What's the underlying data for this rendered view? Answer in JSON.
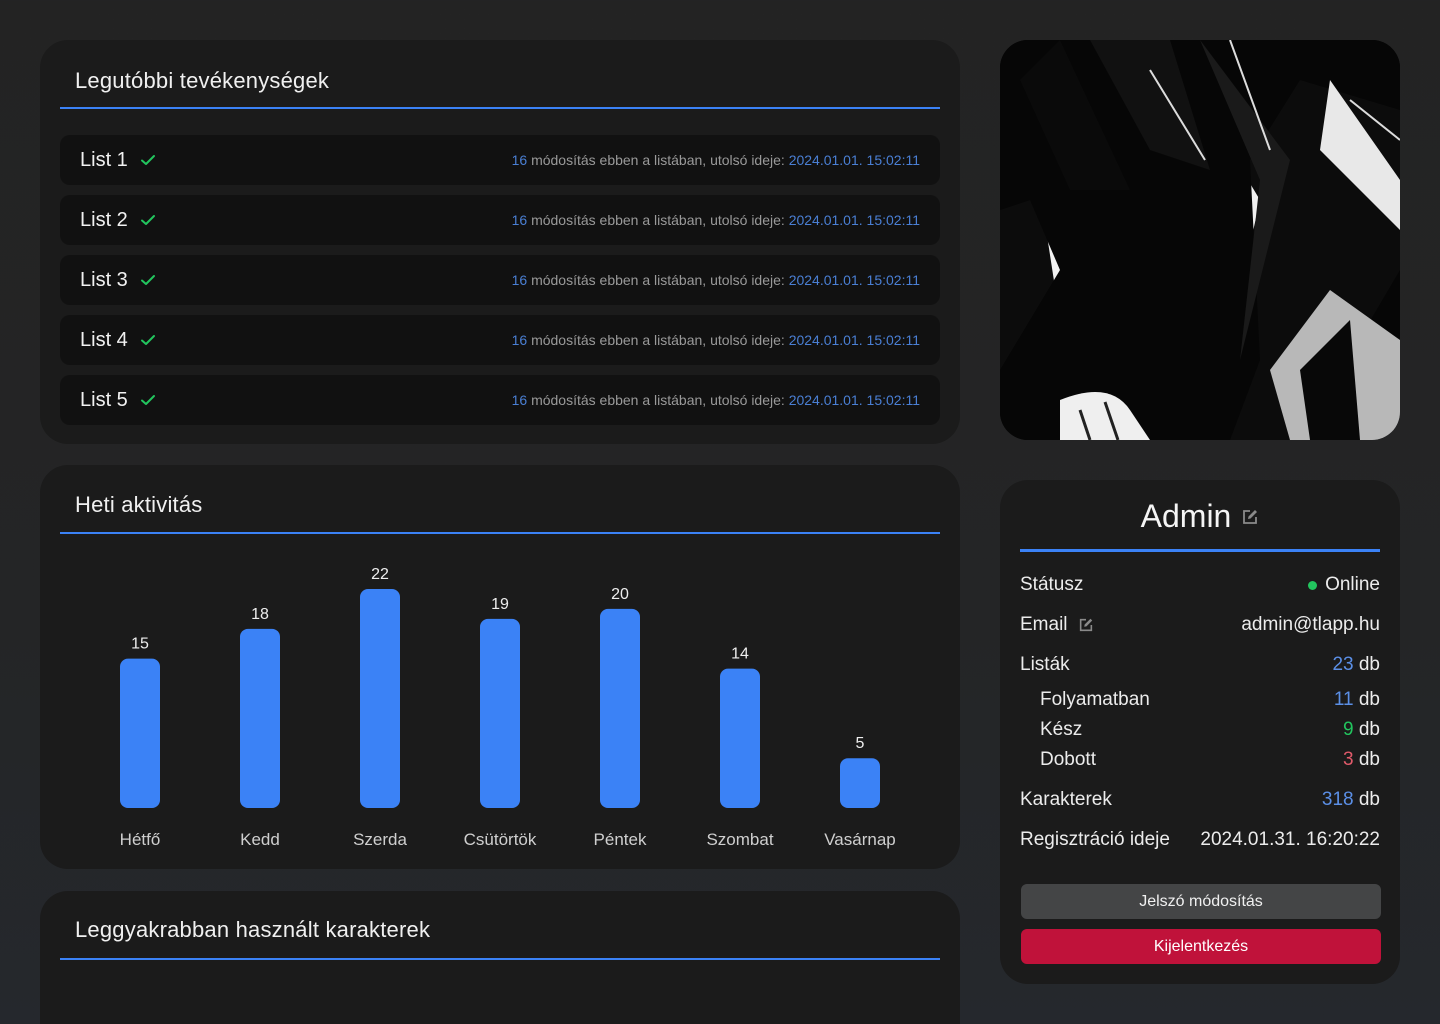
{
  "recent": {
    "title": "Legutóbbi tevékenységek",
    "items": [
      {
        "name": "List 1",
        "count": "16",
        "text": "módosítás ebben a listában, utolsó ideje:",
        "time": "2024.01.01. 15:02:11"
      },
      {
        "name": "List 2",
        "count": "16",
        "text": "módosítás ebben a listában, utolsó ideje:",
        "time": "2024.01.01. 15:02:11"
      },
      {
        "name": "List 3",
        "count": "16",
        "text": "módosítás ebben a listában, utolsó ideje:",
        "time": "2024.01.01. 15:02:11"
      },
      {
        "name": "List 4",
        "count": "16",
        "text": "módosítás ebben a listában, utolsó ideje:",
        "time": "2024.01.01. 15:02:11"
      },
      {
        "name": "List 5",
        "count": "16",
        "text": "módosítás ebben a listában, utolsó ideje:",
        "time": "2024.01.01. 15:02:11"
      }
    ]
  },
  "weekly": {
    "title": "Heti aktivitás"
  },
  "chart_data": {
    "type": "bar",
    "categories": [
      "Hétfő",
      "Kedd",
      "Szerda",
      "Csütörtök",
      "Péntek",
      "Szombat",
      "Vasárnap"
    ],
    "values": [
      15,
      18,
      22,
      19,
      20,
      14,
      5
    ],
    "title": "Heti aktivitás",
    "xlabel": "",
    "ylabel": "",
    "ylim": [
      0,
      22
    ],
    "grid": false,
    "bar_color": "#3b82f6"
  },
  "chars": {
    "title": "Leggyakrabban használt karakterek"
  },
  "avatar": {
    "icon": "avatar-image"
  },
  "profile": {
    "name": "Admin",
    "status_label": "Státusz",
    "status_value": "Online",
    "email_label": "Email",
    "email_value": "admin@tlapp.hu",
    "lists_label": "Listák",
    "lists_value": "23",
    "in_progress_label": "Folyamatban",
    "in_progress_value": "11",
    "done_label": "Kész",
    "done_value": "9",
    "dropped_label": "Dobott",
    "dropped_value": "3",
    "chars_label": "Karakterek",
    "chars_value": "318",
    "reg_label": "Regisztráció ideje",
    "reg_value": "2024.01.31. 16:20:22",
    "unit": "db",
    "change_password": "Jelszó módosítás",
    "logout": "Kijelentkezés"
  },
  "colors": {
    "accent": "#3b82f6",
    "online": "#22c55e",
    "danger": "#c0123a"
  }
}
